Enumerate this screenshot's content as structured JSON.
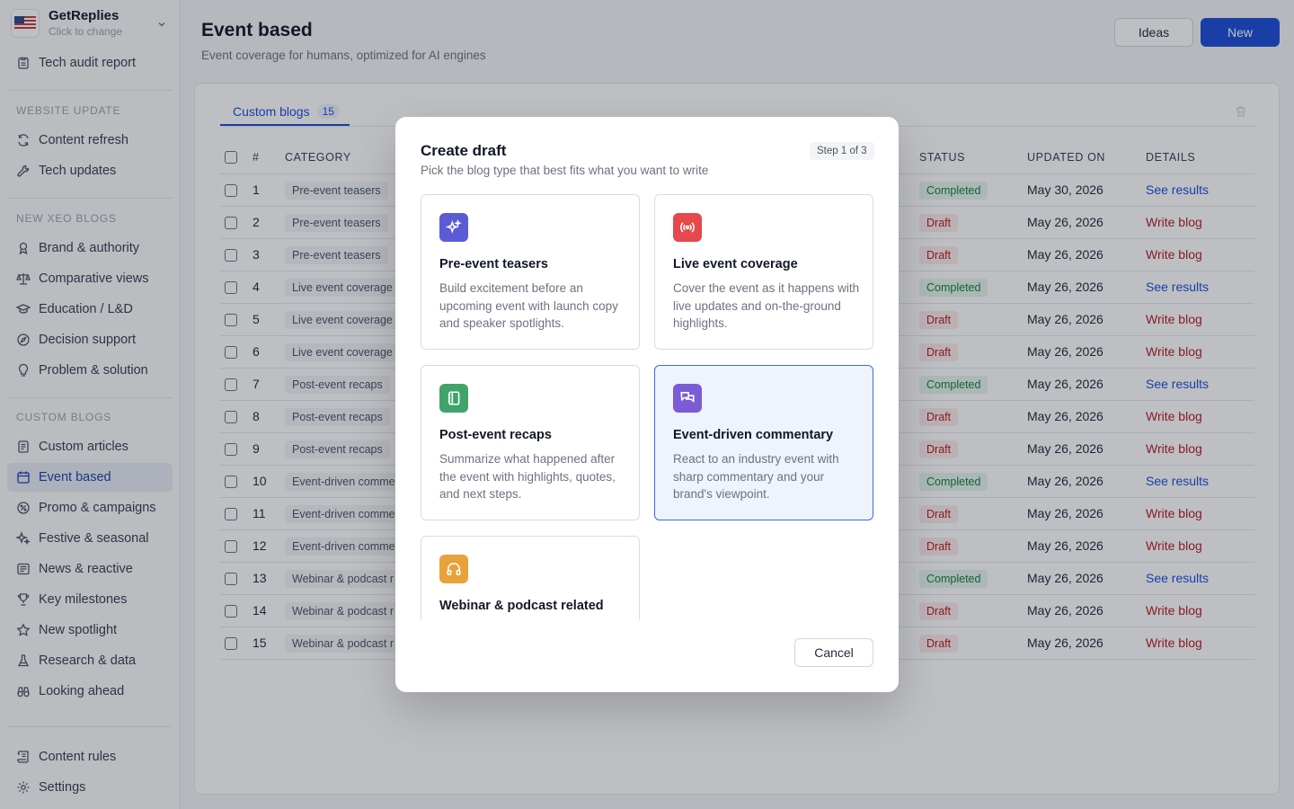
{
  "brand": {
    "name": "GetReplies",
    "sub": "Click to change",
    "flag_icon": "us-flag-icon"
  },
  "sidebar": {
    "top_item": "Tech audit report",
    "sections": [
      {
        "title": "WEBSITE UPDATE",
        "items": [
          "Content refresh",
          "Tech updates"
        ]
      },
      {
        "title": "NEW XEO BLOGS",
        "items": [
          "Brand & authority",
          "Comparative views",
          "Education / L&D",
          "Decision support",
          "Problem & solution"
        ]
      },
      {
        "title": "CUSTOM BLOGS",
        "items": [
          "Custom articles",
          "Event based",
          "Promo & campaigns",
          "Festive & seasonal",
          "News & reactive",
          "Key milestones",
          "New spotlight",
          "Research & data",
          "Looking ahead"
        ]
      }
    ],
    "active": "Event based",
    "bottom": [
      "Content rules",
      "Settings"
    ]
  },
  "header": {
    "title": "Event based",
    "subtitle": "Event coverage for humans, optimized for AI engines",
    "ideas_label": "Ideas",
    "new_label": "New"
  },
  "tabs": [
    {
      "label": "Custom blogs",
      "count": "15"
    }
  ],
  "table": {
    "columns": [
      "#",
      "CATEGORY",
      "STATUS",
      "UPDATED ON",
      "DETAILS"
    ],
    "rows": [
      {
        "num": "1",
        "category": "Pre-event teasers",
        "status": "Completed",
        "date": "May 30, 2026",
        "link": "See results"
      },
      {
        "num": "2",
        "category": "Pre-event teasers",
        "status": "Draft",
        "date": "May 26, 2026",
        "link": "Write blog"
      },
      {
        "num": "3",
        "category": "Pre-event teasers",
        "status": "Draft",
        "date": "May 26, 2026",
        "link": "Write blog"
      },
      {
        "num": "4",
        "category": "Live event coverage",
        "status": "Completed",
        "date": "May 26, 2026",
        "link": "See results"
      },
      {
        "num": "5",
        "category": "Live event coverage",
        "status": "Draft",
        "date": "May 26, 2026",
        "link": "Write blog"
      },
      {
        "num": "6",
        "category": "Live event coverage",
        "status": "Draft",
        "date": "May 26, 2026",
        "link": "Write blog"
      },
      {
        "num": "7",
        "category": "Post-event recaps",
        "status": "Completed",
        "date": "May 26, 2026",
        "link": "See results"
      },
      {
        "num": "8",
        "category": "Post-event recaps",
        "status": "Draft",
        "date": "May 26, 2026",
        "link": "Write blog"
      },
      {
        "num": "9",
        "category": "Post-event recaps",
        "status": "Draft",
        "date": "May 26, 2026",
        "link": "Write blog"
      },
      {
        "num": "10",
        "category": "Event-driven comme",
        "status": "Completed",
        "date": "May 26, 2026",
        "link": "See results"
      },
      {
        "num": "11",
        "category": "Event-driven comme",
        "status": "Draft",
        "date": "May 26, 2026",
        "link": "Write blog"
      },
      {
        "num": "12",
        "category": "Event-driven comme",
        "status": "Draft",
        "date": "May 26, 2026",
        "link": "Write blog"
      },
      {
        "num": "13",
        "category": "Webinar & podcast r",
        "status": "Completed",
        "date": "May 26, 2026",
        "link": "See results"
      },
      {
        "num": "14",
        "category": "Webinar & podcast r",
        "status": "Draft",
        "date": "May 26, 2026",
        "link": "Write blog"
      },
      {
        "num": "15",
        "category": "Webinar & podcast r",
        "status": "Draft",
        "date": "May 26, 2026",
        "link": "Write blog"
      }
    ]
  },
  "modal": {
    "title": "Create draft",
    "subtitle": "Pick the blog type that best fits what you want to write",
    "step": "Step 1 of 3",
    "options": [
      {
        "title": "Pre-event teasers",
        "desc": "Build excitement before an upcoming event with launch copy and speaker spotlights.",
        "icon": "sparkles-icon",
        "color": "#5b5bd6"
      },
      {
        "title": "Live event coverage",
        "desc": "Cover the event as it happens with live updates and on-the-ground highlights.",
        "icon": "broadcast-icon",
        "color": "#e5484d"
      },
      {
        "title": "Post-event recaps",
        "desc": "Summarize what happened after the event with highlights, quotes, and next steps.",
        "icon": "notebook-icon",
        "color": "#3fa46a"
      },
      {
        "title": "Event-driven commentary",
        "desc": "React to an industry event with sharp commentary and your brand's viewpoint.",
        "icon": "chat-bubbles-icon",
        "color": "#7c5cd6"
      },
      {
        "title": "Webinar & podcast related",
        "desc": "",
        "icon": "headphones-icon",
        "color": "#e8a23a"
      }
    ],
    "selected": "Event-driven commentary",
    "cancel_label": "Cancel"
  }
}
